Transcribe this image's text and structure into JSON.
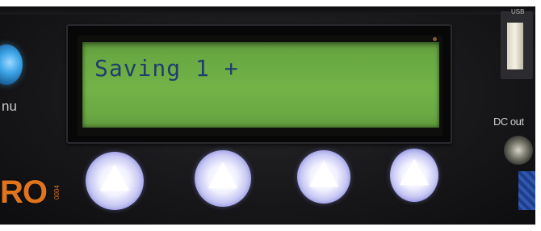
{
  "lcd": {
    "text": "Saving 1 +"
  },
  "labels": {
    "menu": "nu",
    "brand": "RO",
    "brand_sub": "0004",
    "usb": "USB",
    "dc_out": "DC out"
  },
  "buttons": [
    {
      "name": "button-1",
      "icon": "up-arrow-icon"
    },
    {
      "name": "button-2",
      "icon": "up-arrow-icon"
    },
    {
      "name": "button-3",
      "icon": "up-arrow-icon"
    },
    {
      "name": "button-4",
      "icon": "up-arrow-icon"
    }
  ],
  "colors": {
    "lcd_background": "#6aa942",
    "lcd_text": "#1f3d6e",
    "button_glow": "#c8c8f4",
    "brand": "#e0741c"
  }
}
